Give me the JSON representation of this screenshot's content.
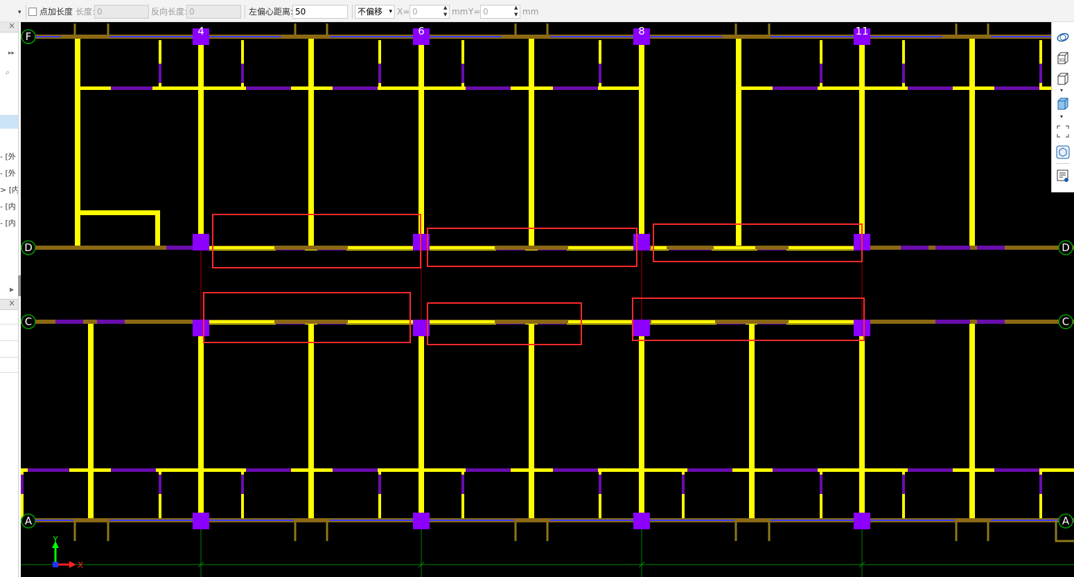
{
  "toolbar": {
    "point_length_label": "点加长度",
    "length_label": "长度:",
    "length_value": "0",
    "reverse_length_label": "反向长度:",
    "reverse_length_value": "0",
    "left_offset_label": "左偏心距离:",
    "left_offset_value": "50",
    "offset_mode": "不偏移",
    "x_label": "X=",
    "x_value": "0",
    "mm1": "mm",
    "y_label": "Y=",
    "y_value": "0",
    "mm2": "mm"
  },
  "left_panel": {
    "items": [
      "[外",
      "[外",
      "[内",
      "[内",
      "[内"
    ]
  },
  "grid_axes": {
    "vertical": [
      "4",
      "6",
      "8",
      "11"
    ],
    "horizontal": [
      "F",
      "D",
      "C",
      "A"
    ]
  },
  "ucs": {
    "x": "X",
    "y": "Y"
  },
  "colors": {
    "wall": "#ffff00",
    "beam": "#8b6914",
    "column": "#8b00ff",
    "opening": "#6a0dad",
    "highlight": "#ff2a2a",
    "axis_marker": "#00a000"
  },
  "right_tools": [
    "orbit-icon",
    "3d-view-icon",
    "box-view-icon",
    "solid-box-icon",
    "select-area-icon",
    "component-icon",
    "properties-icon"
  ]
}
